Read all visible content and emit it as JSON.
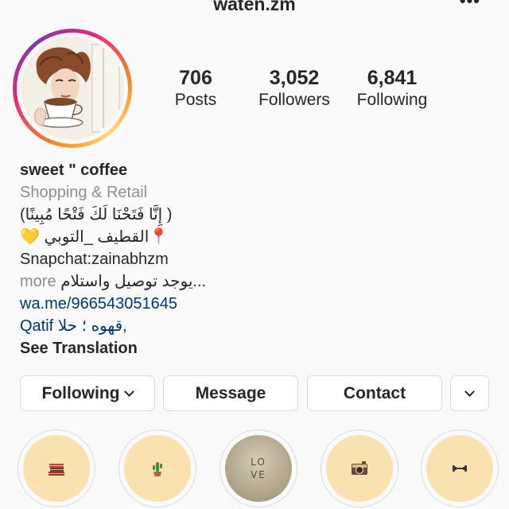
{
  "header": {
    "username": "waten.zm",
    "more_label": "•••"
  },
  "stats": [
    {
      "value": "706",
      "label": "Posts"
    },
    {
      "value": "3,052",
      "label": "Followers"
    },
    {
      "value": "6,841",
      "label": "Following"
    }
  ],
  "bio": {
    "name": "sweet \" coffee",
    "category": "Shopping & Retail",
    "line1": "(إِنَّا فَتَحْنَا لَكَ فَتْحًا مُبِينًا )",
    "line2_text": "القطيف _التوبي",
    "line2_pin": "📍",
    "line2_heart": "💛",
    "snapchat": "Snapchat:zainabhzm",
    "line4_text": "يوجد توصيل واستلام...",
    "more": "more",
    "link": "wa.me/966543051645",
    "location_ar": "قهوه ؛ حلا,",
    "location_en": "Qatif",
    "translate": "See Translation"
  },
  "buttons": {
    "following": "Following",
    "message": "Message",
    "contact": "Contact"
  },
  "highlights": [
    {
      "icon": "books-icon"
    },
    {
      "icon": "cactus-icon"
    },
    {
      "icon": "love-badge",
      "text_top": "LO",
      "text_bottom": "VE"
    },
    {
      "icon": "camera-icon"
    },
    {
      "icon": "dumbbell-icon"
    }
  ],
  "colors": {
    "link": "#00376b",
    "secondary_text": "#8e8e8e",
    "border": "#dbdbdb",
    "highlight_fill": "#f9e2b0"
  }
}
